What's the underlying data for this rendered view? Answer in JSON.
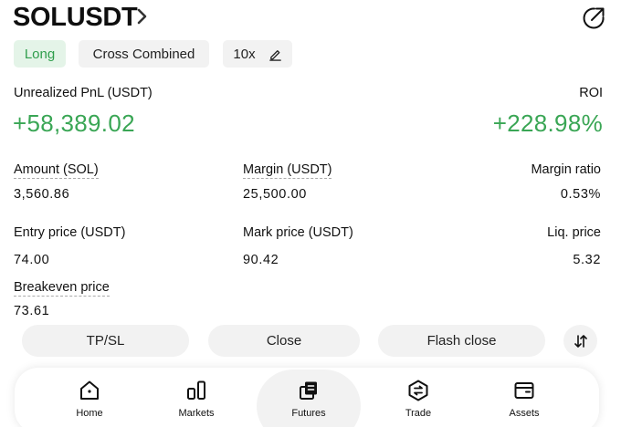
{
  "header": {
    "title": "SOLUSDT",
    "chevron_icon": "chevron-right-icon",
    "share_icon": "share-icon"
  },
  "chips": {
    "side": "Long",
    "margin_mode": "Cross Combined",
    "leverage": "10x",
    "edit_icon": "pencil-icon"
  },
  "pnl": {
    "label": "Unrealized PnL (USDT)",
    "value": "+58,389.02",
    "roi_label": "ROI",
    "roi_value": "+228.98%"
  },
  "stats": [
    {
      "label": "Amount (SOL)",
      "value": "3,560.86"
    },
    {
      "label": "Margin (USDT)",
      "value": "25,500.00"
    },
    {
      "label": "Margin ratio",
      "value": "0.53%"
    },
    {
      "label": "Entry price (USDT)",
      "value": "74.00"
    },
    {
      "label": "Mark price (USDT)",
      "value": "90.42"
    },
    {
      "label": "Liq. price",
      "value": "5.32"
    },
    {
      "label": "Breakeven price",
      "value": "73.61"
    }
  ],
  "actions": {
    "tpsl": "TP/SL",
    "close": "Close",
    "flash_close": "Flash close",
    "sort_icon": "sort-arrows-icon"
  },
  "nav": [
    {
      "label": "Home",
      "icon": "home-icon"
    },
    {
      "label": "Markets",
      "icon": "bar-chart-icon"
    },
    {
      "label": "Futures",
      "icon": "futures-icon",
      "active": true
    },
    {
      "label": "Trade",
      "icon": "trade-hexagon-icon"
    },
    {
      "label": "Assets",
      "icon": "wallet-icon"
    }
  ],
  "colors": {
    "positive": "#3aa655",
    "chip_long_bg": "#e4f4e8",
    "chip_bg": "#f2f2f2"
  }
}
